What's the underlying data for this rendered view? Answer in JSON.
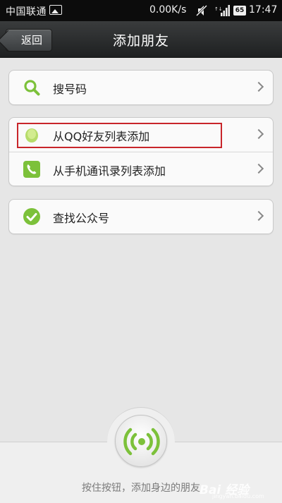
{
  "status_bar": {
    "carrier": "中国联通",
    "speed": "0.00K/s",
    "battery": "65",
    "time": "17:47"
  },
  "title_bar": {
    "back_label": "返回",
    "title": "添加朋友"
  },
  "groups": [
    {
      "items": [
        {
          "label": "搜号码",
          "icon": "search-icon"
        }
      ]
    },
    {
      "items": [
        {
          "label": "从QQ好友列表添加",
          "icon": "qq-penguin-icon"
        },
        {
          "label": "从手机通讯录列表添加",
          "icon": "phone-contacts-icon"
        }
      ]
    },
    {
      "items": [
        {
          "label": "查找公众号",
          "icon": "checkmark-icon"
        }
      ]
    }
  ],
  "bottom": {
    "radar_icon": "radar-signal-icon",
    "hint": "按住按钮，添加身边的朋友"
  },
  "watermark": {
    "text": "Bai 经验",
    "sub": "jingyan.baidu.com"
  },
  "colors": {
    "accent_green": "#7cc13a",
    "highlight_red": "#c8252a"
  }
}
